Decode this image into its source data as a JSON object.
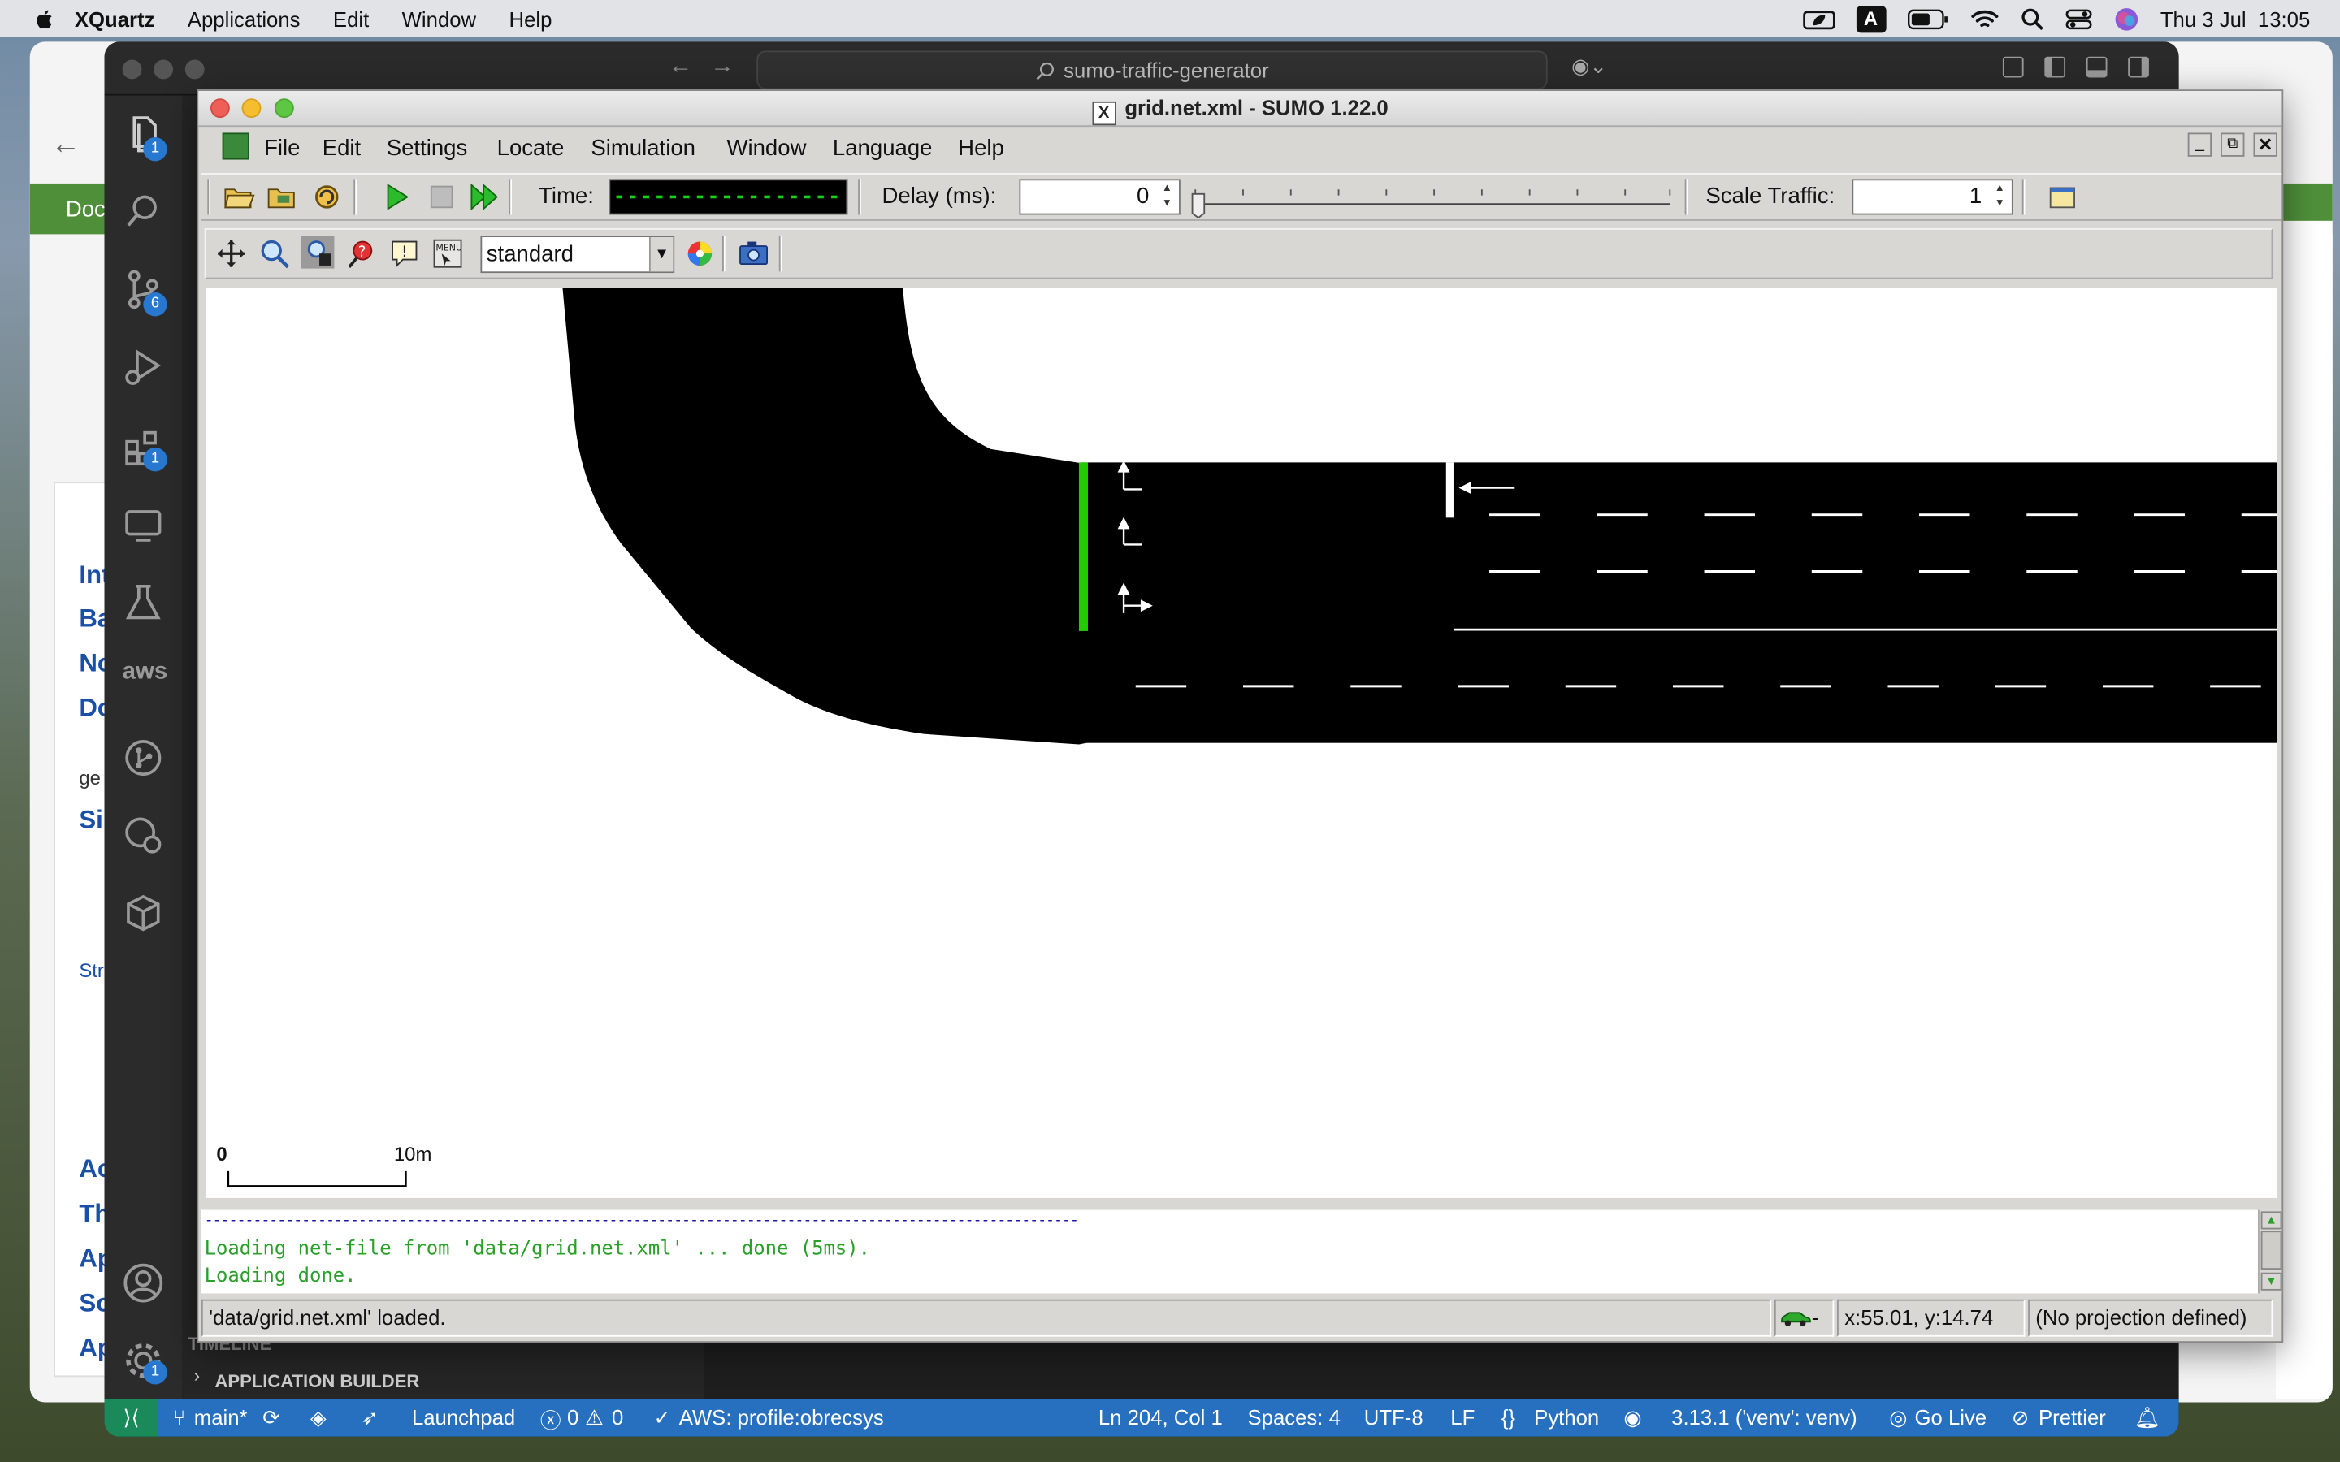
{
  "mac_menubar": {
    "app": "XQuartz",
    "items": [
      "Applications",
      "Edit",
      "Window",
      "Help"
    ],
    "ime": "A",
    "clock": "Thu 3 Jul  13:05"
  },
  "browser": {
    "doc_label": "Doc",
    "side_links": [
      "Int",
      "Ba",
      "No",
      "Do",
      "ge",
      "Si",
      "Str",
      "Ac",
      "Th",
      "Ap",
      "So",
      "Ap"
    ]
  },
  "vscode": {
    "search_text": "sumo-traffic-generator",
    "badges": {
      "explorer": "1",
      "scm": "6",
      "extensions": "1",
      "remote": "1",
      "accounts": "1"
    },
    "aws_label": "aws",
    "sidebar": {
      "timeline": "TIMELINE",
      "app_builder": "APPLICATION BUILDER"
    },
    "statusbar": {
      "branch": "main*",
      "launchpad": "Launchpad",
      "problems": "0",
      "warnings": "0",
      "aws": "AWS: profile:obrecsys",
      "position": "Ln 204, Col 1",
      "spaces": "Spaces: 4",
      "encoding": "UTF-8",
      "eol": "LF",
      "language": "Python",
      "interpreter": "3.13.1 ('venv': venv)",
      "golive": "Go Live",
      "prettier": "Prettier"
    }
  },
  "sumo": {
    "title": "grid.net.xml - SUMO 1.22.0",
    "menu": [
      "File",
      "Edit",
      "Settings",
      "Locate",
      "Simulation",
      "Window",
      "Language",
      "Help"
    ],
    "time_label": "Time:",
    "delay_label": "Delay (ms):",
    "delay_value": "0",
    "scale_label": "Scale Traffic:",
    "scale_value": "1",
    "scheme": "standard",
    "scale_bar": {
      "start": "0",
      "end": "10m"
    },
    "messages": [
      "------------------------------------------------------------------------------------------------------------",
      "Loading net-file from 'data/grid.net.xml' ... done (5ms).",
      "Loading done."
    ],
    "status": {
      "text": "'data/grid.net.xml' loaded.",
      "vehicle_mode": "-",
      "coords": "x:55.01, y:14.74",
      "projection": "(No projection defined)"
    },
    "signal_color": "#22cc00",
    "message_color": "#2aa02a"
  }
}
